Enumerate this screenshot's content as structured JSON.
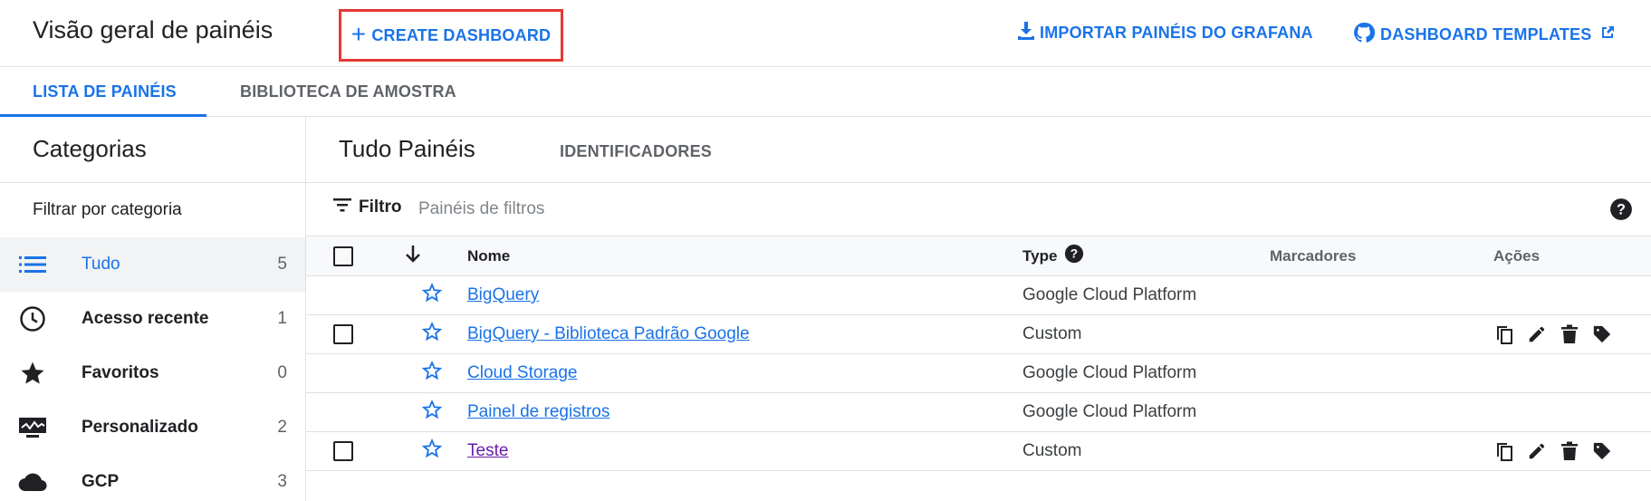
{
  "header": {
    "title": "Visão geral de painéis",
    "create_label": "CREATE DASHBOARD",
    "import_label": "IMPORTAR PAINÉIS DO GRAFANA",
    "templates_label": "DASHBOARD TEMPLATES"
  },
  "tabs": [
    {
      "label": "LISTA DE PAINÉIS",
      "active": true
    },
    {
      "label": "BIBLIOTECA DE AMOSTRA",
      "active": false
    }
  ],
  "sidebar": {
    "title": "Categorias",
    "filter_label": "Filtrar por categoria",
    "items": [
      {
        "label": "Tudo",
        "count": "5",
        "icon": "list-icon",
        "active": true
      },
      {
        "label": "Acesso recente",
        "count": "1",
        "icon": "clock-icon"
      },
      {
        "label": "Favoritos",
        "count": "0",
        "icon": "star-filled-icon"
      },
      {
        "label": "Personalizado",
        "count": "2",
        "icon": "monitor-chart-icon"
      },
      {
        "label": "GCP",
        "count": "3",
        "icon": "cloud-icon"
      }
    ]
  },
  "main": {
    "title": "Tudo Painéis",
    "identifiers_tab": "IDENTIFICADORES",
    "filter_label": "Filtro",
    "filter_placeholder": "Painéis de filtros",
    "columns": {
      "name": "Nome",
      "type": "Type",
      "tags": "Marcadores",
      "actions": "Ações"
    },
    "rows": [
      {
        "name": "BigQuery",
        "type": "Google Cloud Platform",
        "checkbox": false,
        "actions": false
      },
      {
        "name": "BigQuery - Biblioteca Padrão Google",
        "type": "Custom",
        "checkbox": true,
        "actions": true
      },
      {
        "name": "Cloud Storage",
        "type": "Google Cloud Platform",
        "checkbox": false,
        "actions": false
      },
      {
        "name": "Painel de registros",
        "type": "Google Cloud Platform",
        "checkbox": false,
        "actions": false
      },
      {
        "name": "Teste",
        "type": "Custom",
        "checkbox": true,
        "actions": true,
        "visited": true
      }
    ]
  },
  "colors": {
    "accent": "#1a73e8",
    "highlight_border": "#e53935",
    "visited_link": "#681da8",
    "active_row_bg": "#f1f3f4"
  }
}
